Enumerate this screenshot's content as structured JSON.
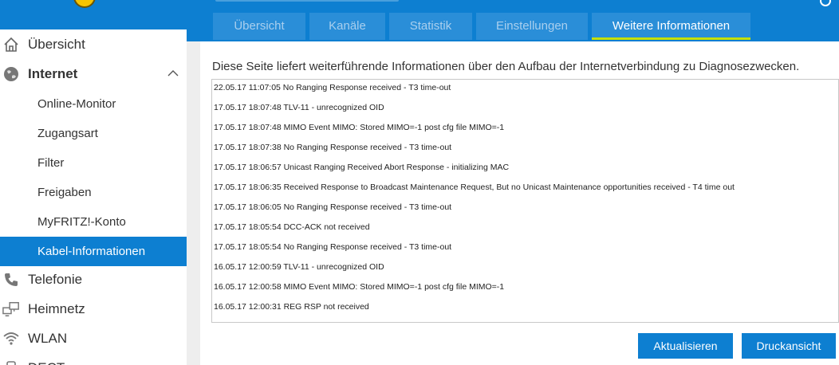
{
  "tabs": [
    {
      "label": "Übersicht",
      "active": false
    },
    {
      "label": "Kanäle",
      "active": false
    },
    {
      "label": "Statistik",
      "active": false
    },
    {
      "label": "Einstellungen",
      "active": false
    },
    {
      "label": "Weitere Informationen",
      "active": true
    }
  ],
  "sidebar": {
    "items": [
      {
        "label": "Übersicht",
        "icon": "home-icon"
      },
      {
        "label": "Internet",
        "icon": "globe-icon",
        "expanded": true,
        "toggle_icon": "chevron-up-icon"
      },
      {
        "label": "Telefonie",
        "icon": "phone-icon"
      },
      {
        "label": "Heimnetz",
        "icon": "network-icon"
      },
      {
        "label": "WLAN",
        "icon": "wifi-icon"
      },
      {
        "label": "DECT",
        "icon": "dect-icon"
      }
    ],
    "sub_items": [
      {
        "label": "Online-Monitor"
      },
      {
        "label": "Zugangsart"
      },
      {
        "label": "Filter"
      },
      {
        "label": "Freigaben"
      },
      {
        "label": "MyFRITZ!-Konto"
      },
      {
        "label": "Kabel-Informationen",
        "selected": true
      }
    ]
  },
  "main": {
    "description": "Diese Seite liefert weiterführende Informationen über den Aufbau der Internetverbindung zu Diagnosezwecken.",
    "log": [
      "22.05.17 11:07:05 No Ranging Response received - T3 time-out",
      "17.05.17 18:07:48 TLV-11 - unrecognized OID",
      "17.05.17 18:07:48 MIMO Event MIMO: Stored MIMO=-1 post cfg file MIMO=-1",
      "17.05.17 18:07:38 No Ranging Response received - T3 time-out",
      "17.05.17 18:06:57 Unicast Ranging Received Abort Response - initializing MAC",
      "17.05.17 18:06:35 Received Response to Broadcast Maintenance Request, But no Unicast Maintenance opportunities received - T4 time out",
      "17.05.17 18:06:05 No Ranging Response received - T3 time-out",
      "17.05.17 18:05:54 DCC-ACK not received",
      "17.05.17 18:05:54 No Ranging Response received - T3 time-out",
      "16.05.17 12:00:59 TLV-11 - unrecognized OID",
      "16.05.17 12:00:58 MIMO Event MIMO: Stored MIMO=-1 post cfg file MIMO=-1",
      "16.05.17 12:00:31 REG RSP not received"
    ],
    "buttons": {
      "refresh": "Aktualisieren",
      "print": "Druckansicht"
    }
  },
  "colors": {
    "brand_blue": "#0d7fd1",
    "tab_blue": "#2a8ed8",
    "active_tab_underline": "#c5e000",
    "logo_yellow": "#f5c400"
  }
}
